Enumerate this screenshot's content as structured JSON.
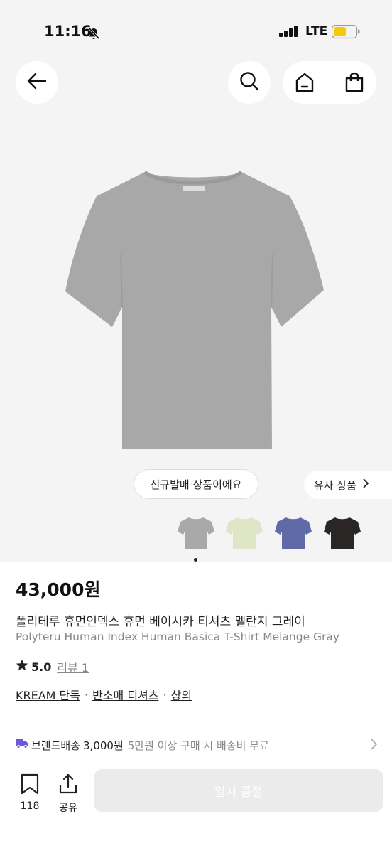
{
  "status_bar": {
    "time": "11:16",
    "network": "LTE"
  },
  "badge_new": "신규발매 상품이에요",
  "similar_button": "유사 상품",
  "colors": {
    "tee_gray": "#a8a8a8",
    "tee_mint": "#dfe6c6",
    "tee_blue": "#5f6aa6",
    "tee_black": "#2a2625",
    "battery": "#f6c90e",
    "ship_icon": "#6b5bd6"
  },
  "thumbnails": [
    {
      "name": "gray",
      "color": "#a8a8a8"
    },
    {
      "name": "mint",
      "color": "#dfe6c6"
    },
    {
      "name": "blue",
      "color": "#5f6aa6"
    },
    {
      "name": "black",
      "color": "#2a2625"
    }
  ],
  "product": {
    "price": "43,000원",
    "name_ko": "폴리테루 휴먼인덱스 휴먼 베이시카 티셔츠 멜란지 그레이",
    "name_en": "Polyteru Human Index Human Basica T-Shirt Melange Gray",
    "rating": "5.0",
    "review_link": "리뷰 1",
    "categories": [
      "KREAM 단독",
      "반소매 티셔츠",
      "상의"
    ],
    "category_sep": "·"
  },
  "shipping": {
    "label": "브랜드배송",
    "amount": "3,000원",
    "note": "5만원 이상 구매 시 배송비 무료"
  },
  "bottom_bar": {
    "bookmark_count": "118",
    "share_label": "공유",
    "cta_label": "일시 품절"
  }
}
